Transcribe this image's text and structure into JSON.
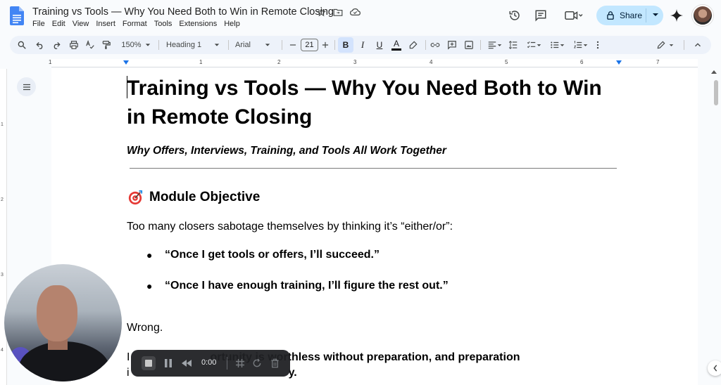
{
  "titlebar": {
    "doc_title": "Training vs Tools — Why You Need Both to Win in Remote Closing",
    "menu": [
      "File",
      "Edit",
      "View",
      "Insert",
      "Format",
      "Tools",
      "Extensions",
      "Help"
    ],
    "share_label": "Share"
  },
  "toolbar": {
    "zoom": "150%",
    "style": "Heading 1",
    "font": "Arial",
    "font_size": "21",
    "bold_label": "B",
    "italic_label": "I",
    "underline_label": "U",
    "text_color_label": "A"
  },
  "ruler": {
    "numbers": [
      "1",
      "1",
      "2",
      "3",
      "4",
      "5",
      "6",
      "7"
    ]
  },
  "vruler": {
    "numbers": [
      "1",
      "2",
      "3",
      "4"
    ]
  },
  "document": {
    "title": "Training vs Tools — Why You Need Both to Win in Remote Closing",
    "subtitle": "Why Offers, Interviews, Training, and Tools All Work Together",
    "section_heading": "Module Objective",
    "intro": "Too many closers sabotage themselves by thinking it’s “either/or”:",
    "bullets": [
      "“Once I get tools or offers, I’ll succeed.”",
      "“Once I have enough training, I’ll figure the rest out.”"
    ],
    "bullet_glyph": "●",
    "wrong": "Wrong.",
    "last_para_start": "I",
    "last_para_bold": "ortunity is worthless without preparation, and preparation",
    "last_para_line2_start": "i",
    "last_para_line2_end": "y."
  },
  "recording": {
    "time": "0:00"
  },
  "colors": {
    "accent": "#1a73e8",
    "share_bg": "#c2e7ff",
    "toolbar_bg": "#edf2fa",
    "recbar_bg": "#202124"
  }
}
